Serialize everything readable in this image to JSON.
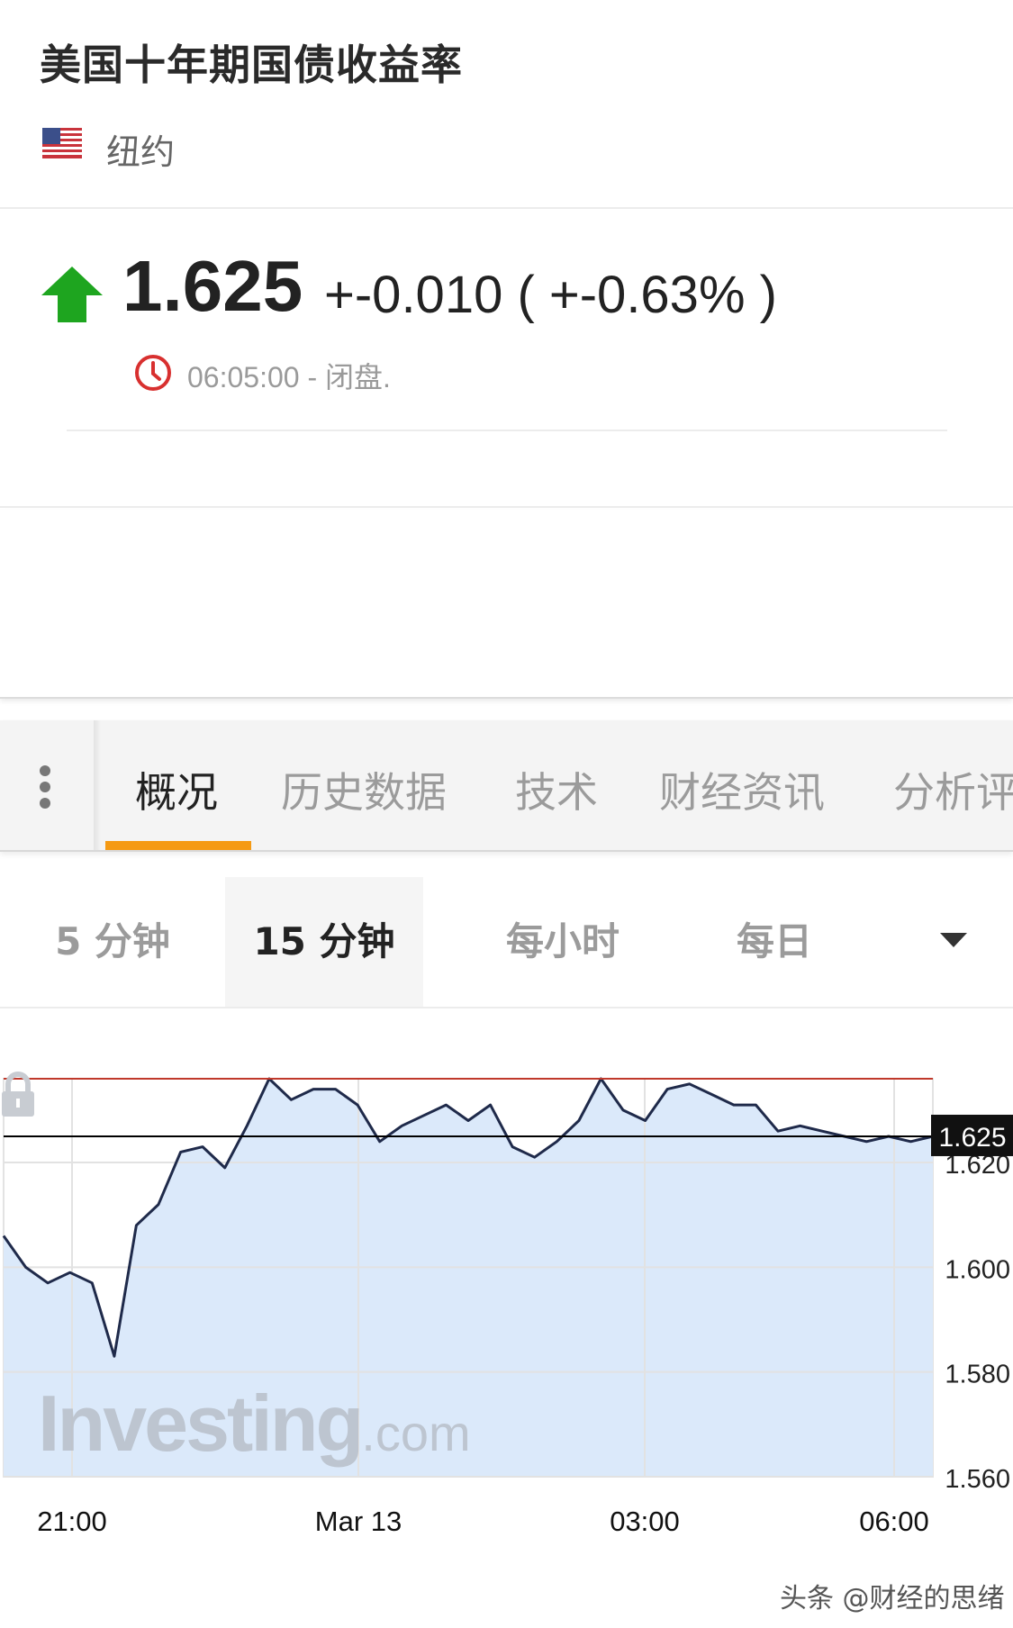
{
  "header": {
    "title": "美国十年期国债收益率",
    "location": "纽约",
    "flag_icon": "us-flag-icon"
  },
  "quote": {
    "price": "1.625",
    "change": "+-0.010 ( +-0.63% )",
    "direction": "up",
    "arrow_color": "#1ea51f",
    "time": "06:05:00 - 闭盘."
  },
  "tabs": {
    "items": [
      {
        "label": "概况",
        "active": true
      },
      {
        "label": "历史数据",
        "active": false
      },
      {
        "label": "技术",
        "active": false
      },
      {
        "label": "财经资讯",
        "active": false
      },
      {
        "label": "分析评",
        "active": false
      }
    ],
    "accent_color": "#f59a14"
  },
  "intervals": {
    "items": [
      {
        "label": "5 分钟",
        "active": false
      },
      {
        "label": "15 分钟",
        "active": true
      },
      {
        "label": "每小时",
        "active": false
      },
      {
        "label": "每日",
        "active": false
      }
    ]
  },
  "chart_data": {
    "type": "area",
    "current_value_label": "1.625",
    "ylim": [
      1.56,
      1.635
    ],
    "y_ticks": [
      "1.620",
      "1.600",
      "1.580",
      "1.560"
    ],
    "x_ticks": [
      "21:00",
      "Mar 13",
      "03:00",
      "06:00"
    ],
    "reference_line": 1.636,
    "reference_line_color": "#c0392b",
    "fill_color": "#dbe9fa",
    "line_color": "#1f2a4a",
    "series": [
      {
        "values": [
          1.606,
          1.6,
          1.597,
          1.599,
          1.597,
          1.583,
          1.608,
          1.612,
          1.622,
          1.623,
          1.619,
          1.627,
          1.636,
          1.632,
          1.634,
          1.634,
          1.631,
          1.624,
          1.627,
          1.629,
          1.631,
          1.628,
          1.631,
          1.623,
          1.621,
          1.624,
          1.628,
          1.636,
          1.63,
          1.628,
          1.634,
          1.635,
          1.633,
          1.631,
          1.631,
          1.626,
          1.627,
          1.626,
          1.625,
          1.624,
          1.625,
          1.624,
          1.625
        ]
      }
    ],
    "watermark": "Investing",
    "watermark_suffix": ".com"
  },
  "footer": {
    "credit": "头条 @财经的思绪"
  }
}
